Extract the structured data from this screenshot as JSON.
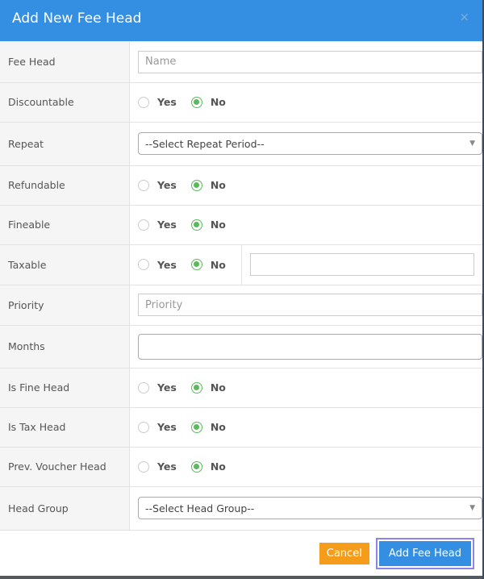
{
  "modal": {
    "title": "Add New Fee Head",
    "close_icon": "×"
  },
  "rows": [
    {
      "label": "Fee Head",
      "type": "input",
      "placeholder": "Name",
      "value": ""
    },
    {
      "label": "Discountable",
      "type": "radio",
      "options": [
        "Yes",
        "No"
      ],
      "selected": "No"
    },
    {
      "label": "Repeat",
      "type": "select",
      "value": "--Select Repeat Period--"
    },
    {
      "label": "Refundable",
      "type": "radio",
      "options": [
        "Yes",
        "No"
      ],
      "selected": "No"
    },
    {
      "label": "Fineable",
      "type": "radio",
      "options": [
        "Yes",
        "No"
      ],
      "selected": "No"
    },
    {
      "label": "Taxable",
      "type": "radio-input",
      "options": [
        "Yes",
        "No"
      ],
      "selected": "No",
      "value": ""
    },
    {
      "label": "Priority",
      "type": "input",
      "placeholder": "Priority",
      "value": ""
    },
    {
      "label": "Months",
      "type": "multiselect",
      "value": ""
    },
    {
      "label": "Is Fine Head",
      "type": "radio",
      "options": [
        "Yes",
        "No"
      ],
      "selected": "No"
    },
    {
      "label": "Is Tax Head",
      "type": "radio",
      "options": [
        "Yes",
        "No"
      ],
      "selected": "No"
    },
    {
      "label": "Prev. Voucher Head",
      "type": "radio",
      "options": [
        "Yes",
        "No"
      ],
      "selected": "No"
    },
    {
      "label": "Head Group",
      "type": "select",
      "value": "--Select Head Group--"
    }
  ],
  "footer": {
    "cancel_label": "Cancel",
    "submit_label": "Add Fee Head"
  },
  "colors": {
    "header": "#348fe2",
    "radio_selected": "#5cb85c",
    "cancel": "#f59c1a",
    "submit": "#348fe2",
    "focus_ring": "#8a84ee"
  }
}
